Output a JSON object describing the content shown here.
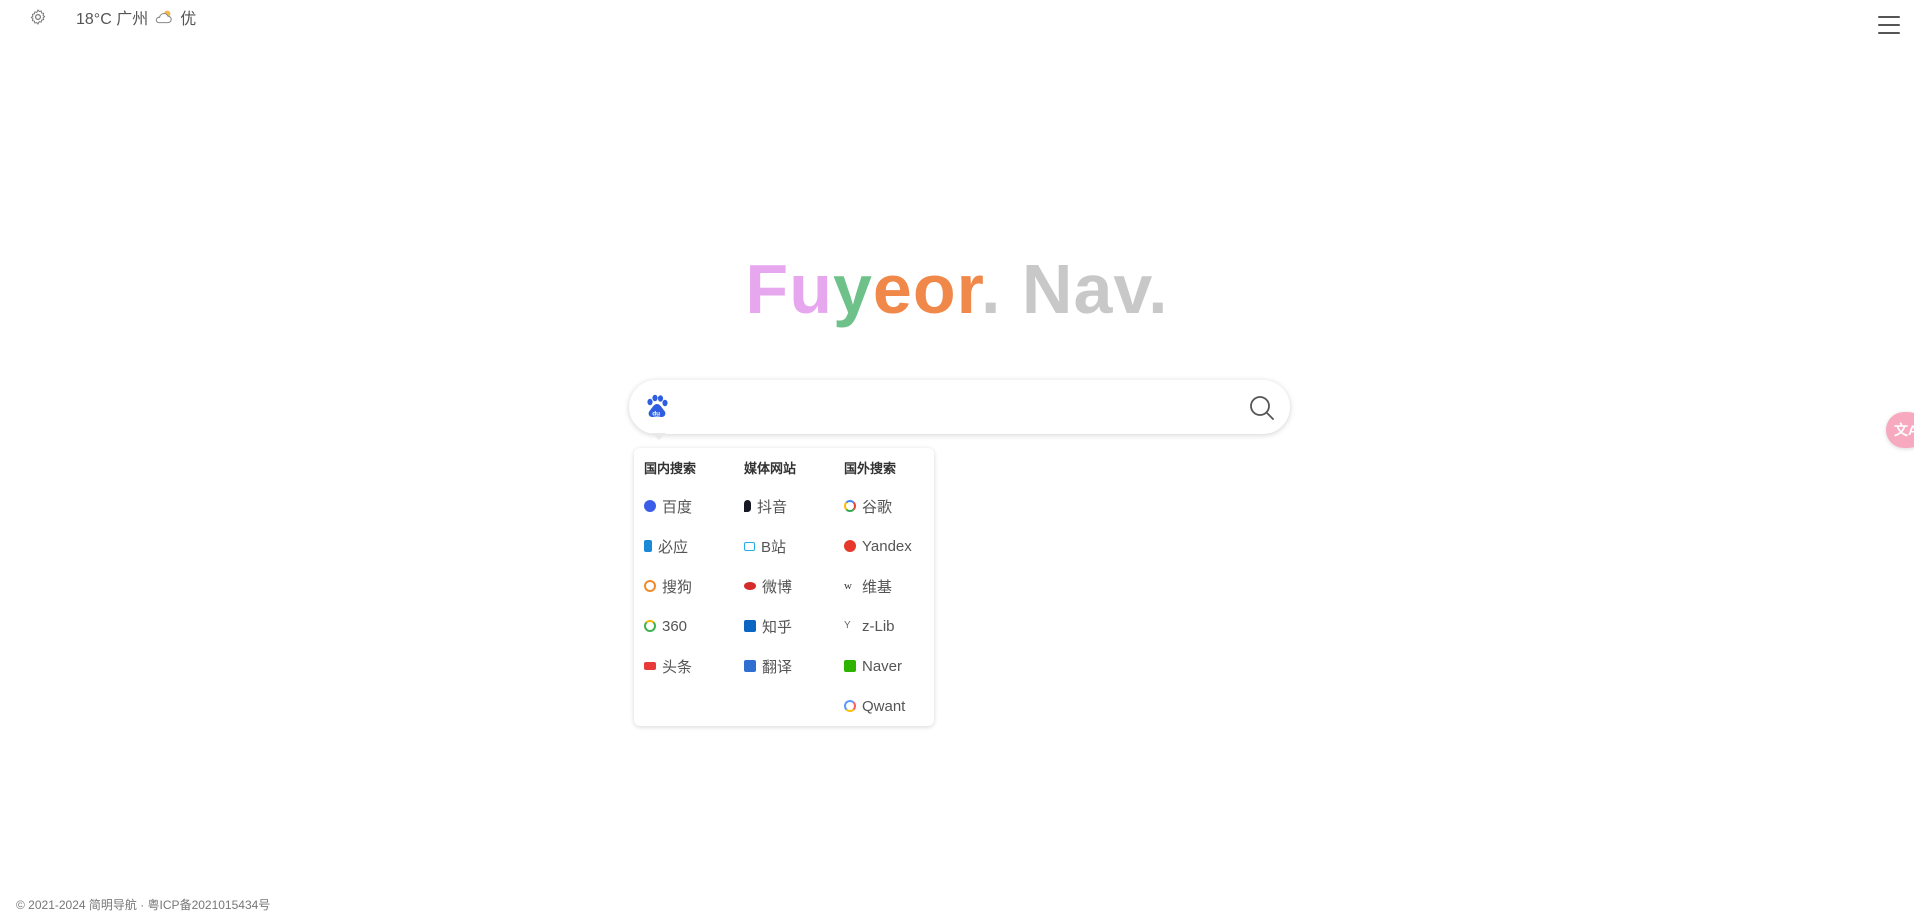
{
  "topbar": {
    "weather_text": "18°C 广州",
    "air_quality": "优",
    "icons": {
      "settings": "gear-icon",
      "weather": "partly-cloudy-icon",
      "menu": "hamburger-menu-icon"
    }
  },
  "logo": {
    "letters": [
      "F",
      "u",
      "y",
      "e",
      "o",
      "r"
    ],
    "dot1": ".",
    "nav": " Nav",
    "dot2": "."
  },
  "search": {
    "placeholder": "",
    "value": "",
    "current_engine": "baidu-icon"
  },
  "dropdown": {
    "columns": [
      {
        "title": "国内搜索",
        "items": [
          {
            "label": "百度",
            "icon": "baidu-icon",
            "color": "#3b5ee8"
          },
          {
            "label": "必应",
            "icon": "bing-icon",
            "color": "#1a89d6"
          },
          {
            "label": "搜狗",
            "icon": "sogou-icon",
            "color": "#f28a2b"
          },
          {
            "label": "360",
            "icon": "360-icon",
            "color": "#3fb34f"
          },
          {
            "label": "头条",
            "icon": "toutiao-icon",
            "color": "#e83a3a"
          }
        ]
      },
      {
        "title": "媒体网站",
        "items": [
          {
            "label": "抖音",
            "icon": "douyin-icon",
            "color": "#161823"
          },
          {
            "label": "B站",
            "icon": "bilibili-icon",
            "color": "#23ade5"
          },
          {
            "label": "微博",
            "icon": "weibo-icon",
            "color": "#d52c2b"
          },
          {
            "label": "知乎",
            "icon": "zhihu-icon",
            "color": "#0a66c2"
          },
          {
            "label": "翻译",
            "icon": "translate-icon",
            "color": "#2f6fd0"
          }
        ]
      },
      {
        "title": "国外搜索",
        "items": [
          {
            "label": "谷歌",
            "icon": "google-icon",
            "color": "#4285f4"
          },
          {
            "label": "Yandex",
            "icon": "yandex-icon",
            "color": "#e6392b"
          },
          {
            "label": "维基",
            "icon": "wikipedia-icon",
            "color": "#333333"
          },
          {
            "label": "z-Lib",
            "icon": "zlib-icon",
            "color": "#555555"
          },
          {
            "label": "Naver",
            "icon": "naver-icon",
            "color": "#2db400"
          },
          {
            "label": "Qwant",
            "icon": "qwant-icon",
            "color": "#5c97ff"
          }
        ]
      }
    ]
  },
  "translate_fab": {
    "label": "文A",
    "icon": "translate-icon"
  },
  "footer": {
    "text": "© 2021-2024 简明导航 · 粤ICP备2021015434号"
  }
}
